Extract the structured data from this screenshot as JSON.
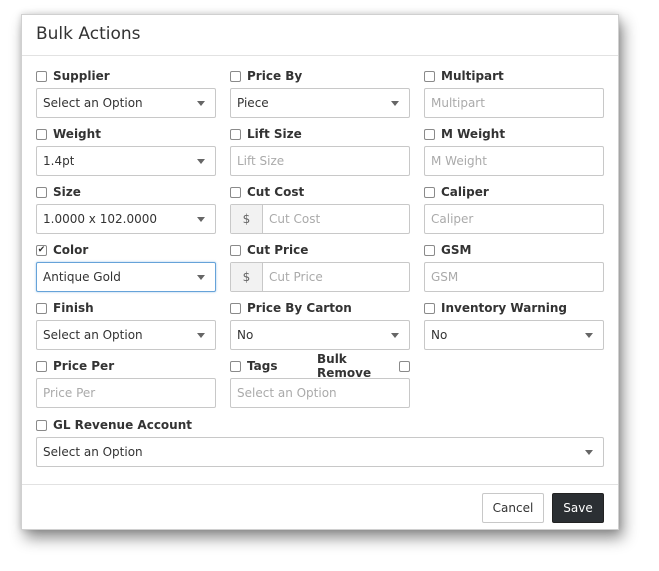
{
  "modal": {
    "title": "Bulk Actions"
  },
  "fields": {
    "supplier": {
      "label": "Supplier",
      "value": "Select an Option"
    },
    "price_by": {
      "label": "Price By",
      "value": "Piece"
    },
    "multipart": {
      "label": "Multipart",
      "placeholder": "Multipart"
    },
    "weight": {
      "label": "Weight",
      "value": "1.4pt"
    },
    "lift_size": {
      "label": "Lift Size",
      "placeholder": "Lift Size"
    },
    "m_weight": {
      "label": "M Weight",
      "placeholder": "M Weight"
    },
    "size": {
      "label": "Size",
      "value": "1.0000 x 102.0000"
    },
    "cut_cost": {
      "label": "Cut Cost",
      "addon": "$",
      "placeholder": "Cut Cost"
    },
    "caliper": {
      "label": "Caliper",
      "placeholder": "Caliper"
    },
    "color": {
      "label": "Color",
      "value": "Antique Gold",
      "checked": true
    },
    "cut_price": {
      "label": "Cut Price",
      "addon": "$",
      "placeholder": "Cut Price"
    },
    "gsm": {
      "label": "GSM",
      "placeholder": "GSM"
    },
    "finish": {
      "label": "Finish",
      "value": "Select an Option"
    },
    "price_by_carton": {
      "label": "Price By Carton",
      "value": "No"
    },
    "inventory_warning": {
      "label": "Inventory Warning",
      "value": "No"
    },
    "price_per": {
      "label": "Price Per",
      "placeholder": "Price Per"
    },
    "tags": {
      "label": "Tags",
      "bulk_remove_label": "Bulk Remove",
      "placeholder": "Select an Option"
    },
    "gl_revenue_account": {
      "label": "GL Revenue Account",
      "value": "Select an Option"
    }
  },
  "footer": {
    "cancel_label": "Cancel",
    "save_label": "Save"
  }
}
